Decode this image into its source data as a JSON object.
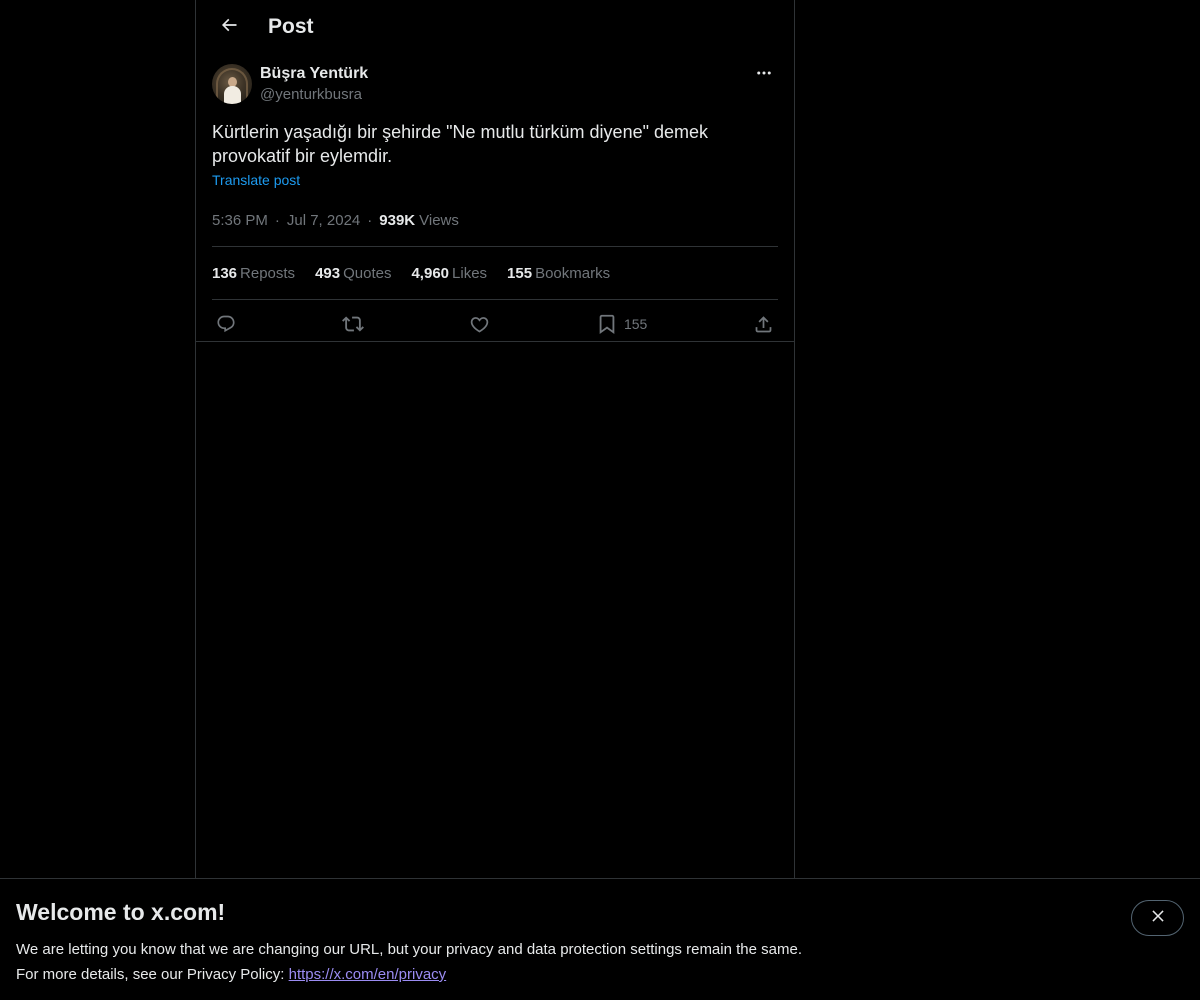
{
  "header": {
    "title": "Post",
    "back_icon": "arrow-left-icon"
  },
  "post": {
    "author": {
      "display_name": "Büşra Yentürk",
      "handle": "@yenturkbusra"
    },
    "text_line1": "Kürtlerin yaşadığı bir şehirde \"Ne mutlu türküm diyene\" demek",
    "text_line2": "provokatif bir eylemdir.",
    "translate_label": "Translate post",
    "time": "5:36 PM",
    "date": "Jul 7, 2024",
    "views_count": "939K",
    "views_label": "Views",
    "separator": "·",
    "stats": {
      "reposts_count": "136",
      "reposts_label": "Reposts",
      "quotes_count": "493",
      "quotes_label": "Quotes",
      "likes_count": "4,960",
      "likes_label": "Likes",
      "bookmarks_count": "155",
      "bookmarks_label": "Bookmarks"
    },
    "actions": {
      "reply_icon": "reply-icon",
      "repost_icon": "repost-icon",
      "like_icon": "heart-icon",
      "bookmark_icon": "bookmark-icon",
      "bookmark_count": "155",
      "share_icon": "share-icon"
    }
  },
  "banner": {
    "title": "Welcome to x.com!",
    "line1": "We are letting you know that we are changing our URL, but your privacy and data protection settings remain the same.",
    "line2_prefix": "For more details, see our Privacy Policy:",
    "link_text": "https://x.com/en/privacy",
    "close_icon": "close-icon"
  },
  "colors": {
    "background": "#000000",
    "text_primary": "#e7e9ea",
    "text_secondary": "#71767b",
    "accent_blue": "#1d9bf0",
    "link_purple": "#9b8cf2",
    "border": "#2f3336"
  }
}
